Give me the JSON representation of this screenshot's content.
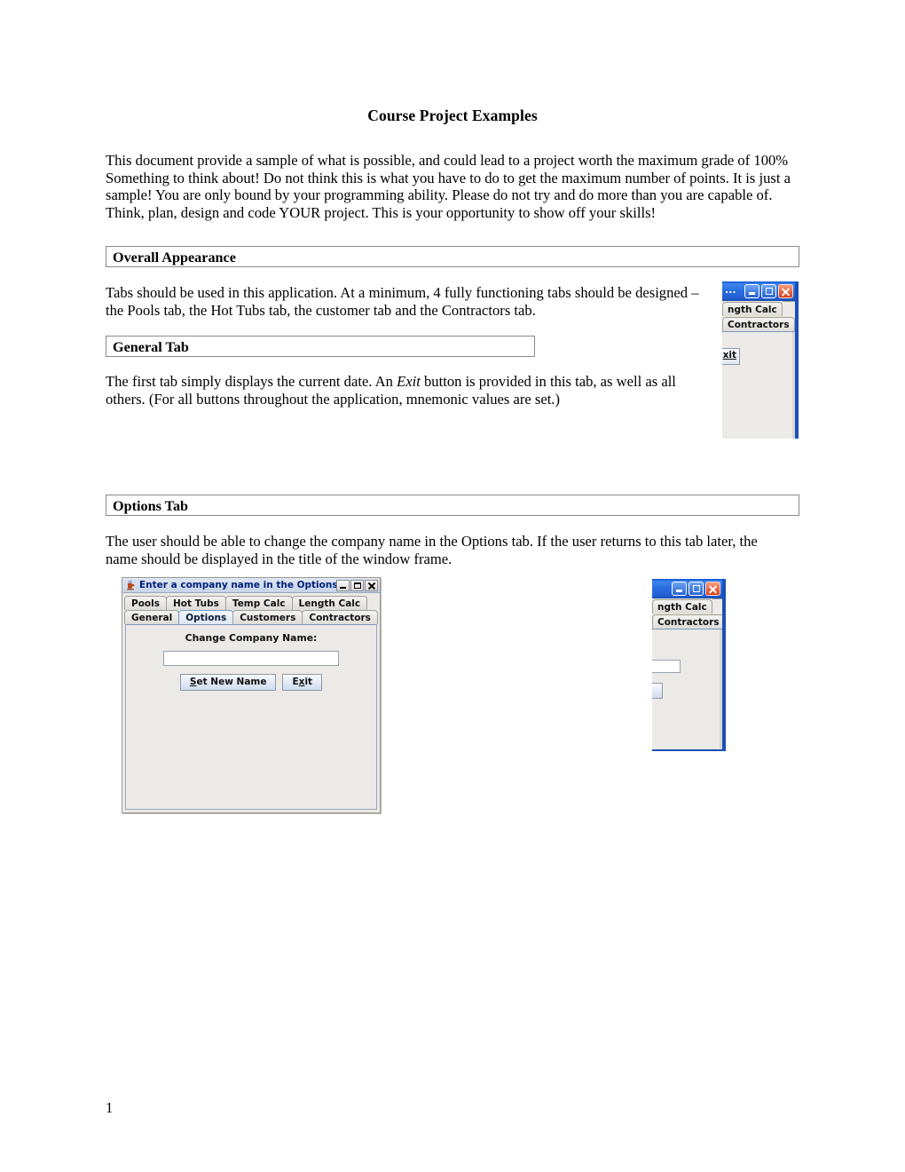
{
  "document": {
    "title": "Course Project Examples",
    "intro": "This document provide a sample of what is possible, and could lead to a project worth the maximum grade of 100% Something to think about! Do not think this is what you have to do to get the maximum number of points.  It is just a sample!  You are only bound by your programming ability.  Please do not try and do more than you are capable of.  Think, plan, design and code YOUR project. This is your opportunity to show off your skills!",
    "page_number": "1"
  },
  "sections": {
    "overall": {
      "heading": "Overall Appearance",
      "body_part1": "Tabs should be used in this application. At a minimum, 4 fully functioning tabs should be designed – the Pools tab, the Hot Tubs tab, the customer tab and the Contractors tab."
    },
    "general": {
      "heading": "General Tab",
      "body_part1": "The first tab simply displays the current date.  An ",
      "body_emphasis": "Exit",
      "body_part2": " button is provided in this tab, as well as all others.  (For all buttons throughout the application, mnemonic values are set.)"
    },
    "options": {
      "heading": "Options Tab",
      "body_part1": "The user should be able to change the company name in the Options tab.  If the user returns to this tab later, the name should be displayed in the title of the window frame."
    }
  },
  "screenshots": {
    "options_window": {
      "title": "Enter a company name in the Options tab",
      "icon": "java-cup-icon",
      "window_buttons": {
        "minimize": "minimize-button",
        "maximize": "maximize-button",
        "close": "close-button"
      },
      "tabs_row1": [
        {
          "label": "Pools",
          "selected": false
        },
        {
          "label": "Hot Tubs",
          "selected": false
        },
        {
          "label": "Temp Calc",
          "selected": false
        },
        {
          "label": "Length Calc",
          "selected": false
        }
      ],
      "tabs_row2": [
        {
          "label": "General",
          "selected": false
        },
        {
          "label": "Options",
          "selected": true
        },
        {
          "label": "Customers",
          "selected": false
        },
        {
          "label": "Contractors",
          "selected": false
        }
      ],
      "form": {
        "label": "Change Company Name:",
        "input_value": "",
        "input_placeholder": "",
        "buttons": [
          {
            "label": "Set New Name",
            "mnemonic": "S"
          },
          {
            "label": "Exit",
            "mnemonic": "x"
          }
        ]
      }
    },
    "clipped_window_top": {
      "title": "...",
      "tabs_row1": [
        {
          "label": "ngth Calc"
        }
      ],
      "tabs_row2": [
        {
          "label": "Contractors"
        }
      ],
      "exit_button_label": "xit"
    },
    "clipped_window_mid": {
      "title": "",
      "tabs_row1": [
        {
          "label": "ngth Calc"
        }
      ],
      "tabs_row2": [
        {
          "label": "Contractors"
        }
      ]
    }
  },
  "colors": {
    "xp_title_blue": "#2a6ee0",
    "xp_close_red": "#d53b16",
    "java_title_text": "#00207a",
    "swing_bg": "#eceae7",
    "selected_tab_border": "#6f9dd0",
    "window_edge_blue": "#1c4fb8"
  }
}
